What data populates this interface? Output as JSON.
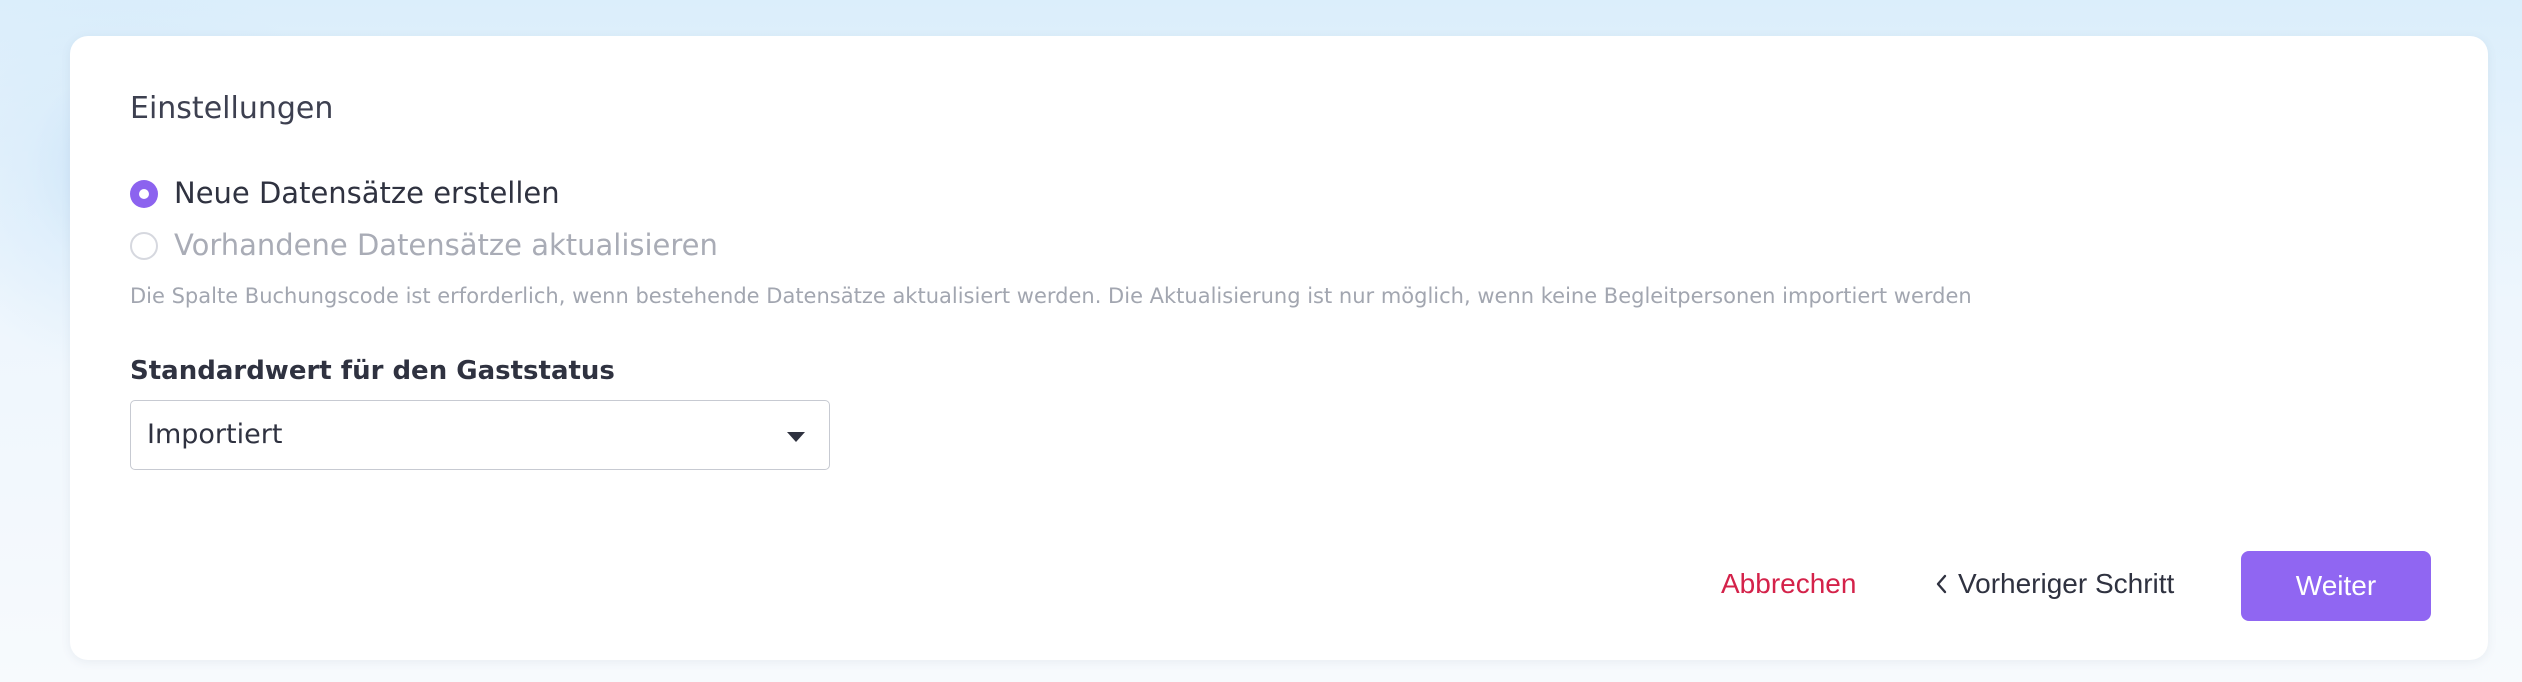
{
  "settings": {
    "title": "Einstellungen",
    "options": [
      {
        "label": "Neue Datensätze erstellen",
        "selected": true
      },
      {
        "label": "Vorhandene Datensätze aktualisieren",
        "selected": false
      }
    ],
    "hint": "Die Spalte Buchungscode ist erforderlich, wenn bestehende Datensätze aktualisiert werden. Die Aktualisierung ist nur möglich, wenn keine Begleitpersonen importiert werden",
    "guest_status_label": "Standardwert für den Gaststatus",
    "guest_status_value": "Importiert"
  },
  "actions": {
    "cancel": "Abbrechen",
    "previous": "Vorheriger Schritt",
    "next": "Weiter"
  },
  "colors": {
    "accent": "#9066f2",
    "danger": "#d4224a",
    "text": "#2f3240",
    "muted": "#a2a6b0"
  },
  "icons": {
    "radio_selected": "radio-selected-icon",
    "radio_unselected": "radio-unselected-icon",
    "dropdown": "chevron-down-icon",
    "previous": "chevron-left-icon"
  }
}
